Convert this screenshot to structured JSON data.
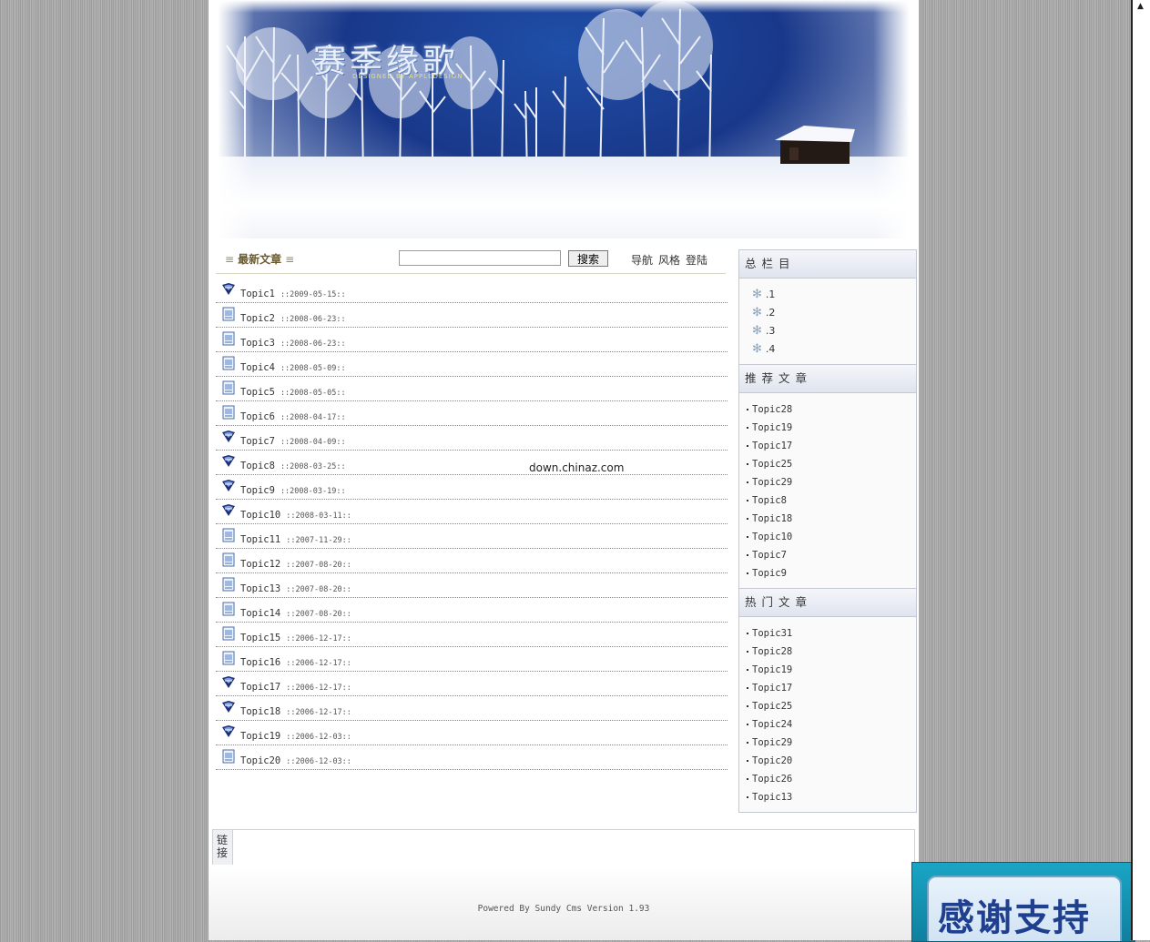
{
  "banner": {
    "title": "赛季缘歌",
    "subtitle": "DESIGNED BY APPLEDESIGN"
  },
  "latest": {
    "title": "最新文章",
    "bars": "≡",
    "search_placeholder": "",
    "search_button": "搜索",
    "links": [
      "导航",
      "风格",
      "登陆"
    ]
  },
  "articles": [
    {
      "title": "Topic1",
      "date": "::2009-05-15::",
      "icon": "shield-icon"
    },
    {
      "title": "Topic2",
      "date": "::2008-06-23::",
      "icon": "document-icon"
    },
    {
      "title": "Topic3",
      "date": "::2008-06-23::",
      "icon": "document-icon"
    },
    {
      "title": "Topic4",
      "date": "::2008-05-09::",
      "icon": "document-icon"
    },
    {
      "title": "Topic5",
      "date": "::2008-05-05::",
      "icon": "document-icon"
    },
    {
      "title": "Topic6",
      "date": "::2008-04-17::",
      "icon": "document-icon"
    },
    {
      "title": "Topic7",
      "date": "::2008-04-09::",
      "icon": "shield-icon"
    },
    {
      "title": "Topic8",
      "date": "::2008-03-25::",
      "icon": "shield-icon"
    },
    {
      "title": "Topic9",
      "date": "::2008-03-19::",
      "icon": "shield-icon"
    },
    {
      "title": "Topic10",
      "date": "::2008-03-11::",
      "icon": "shield-icon"
    },
    {
      "title": "Topic11",
      "date": "::2007-11-29::",
      "icon": "document-icon"
    },
    {
      "title": "Topic12",
      "date": "::2007-08-20::",
      "icon": "document-icon"
    },
    {
      "title": "Topic13",
      "date": "::2007-08-20::",
      "icon": "document-icon"
    },
    {
      "title": "Topic14",
      "date": "::2007-08-20::",
      "icon": "document-icon"
    },
    {
      "title": "Topic15",
      "date": "::2006-12-17::",
      "icon": "document-icon"
    },
    {
      "title": "Topic16",
      "date": "::2006-12-17::",
      "icon": "document-icon"
    },
    {
      "title": "Topic17",
      "date": "::2006-12-17::",
      "icon": "shield-icon"
    },
    {
      "title": "Topic18",
      "date": "::2006-12-17::",
      "icon": "shield-icon"
    },
    {
      "title": "Topic19",
      "date": "::2006-12-03::",
      "icon": "shield-icon"
    },
    {
      "title": "Topic20",
      "date": "::2006-12-03::",
      "icon": "document-icon"
    }
  ],
  "watermark": "down.chinaz.com",
  "sidebar": {
    "categories": {
      "title": "总栏目",
      "items": [
        ".1",
        ".2",
        ".3",
        ".4"
      ]
    },
    "recommended": {
      "title": "推荐文章",
      "items": [
        "Topic28",
        "Topic19",
        "Topic17",
        "Topic25",
        "Topic29",
        "Topic8",
        "Topic18",
        "Topic10",
        "Topic7",
        "Topic9"
      ]
    },
    "hot": {
      "title": "热门文章",
      "items": [
        "Topic31",
        "Topic28",
        "Topic19",
        "Topic17",
        "Topic25",
        "Topic24",
        "Topic29",
        "Topic20",
        "Topic26",
        "Topic13"
      ]
    }
  },
  "links_box": {
    "label": "链接"
  },
  "footer": {
    "text": "Powered By Sundy Cms  Version 1.93"
  },
  "thanks_badge": {
    "text": "感谢支持"
  }
}
